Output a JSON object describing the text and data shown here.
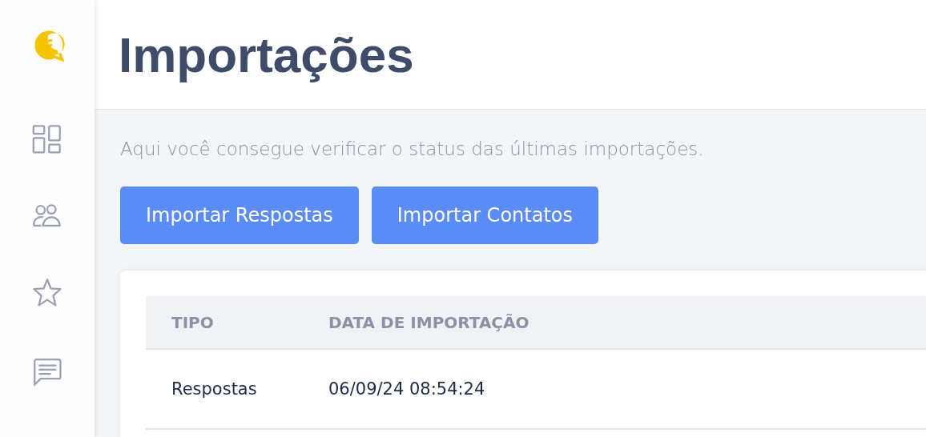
{
  "page": {
    "title": "Importações",
    "description": "Aqui você consegue verificar o status das últimas importações."
  },
  "buttons": [
    "Importar Respostas",
    "Importar Contatos"
  ],
  "table": {
    "columns": [
      "TIPO",
      "DATA DE IMPORTAÇÃO"
    ],
    "rows": [
      [
        "Respostas",
        "06/09/24 08:54:24"
      ]
    ]
  }
}
